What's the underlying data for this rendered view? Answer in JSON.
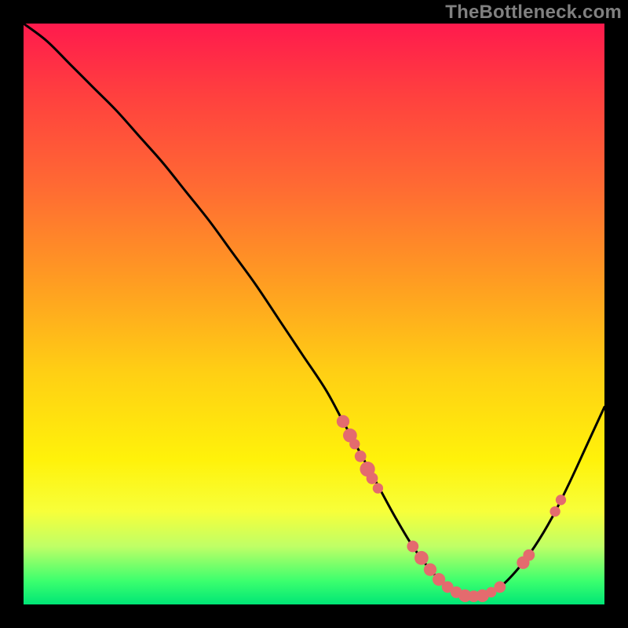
{
  "watermark": "TheBottleneck.com",
  "colors": {
    "background": "#000000",
    "curve": "#000000",
    "dot": "#e46b6e",
    "gradient_top": "#ff1a4d",
    "gradient_bottom": "#00e676"
  },
  "chart_data": {
    "type": "line",
    "title": "",
    "xlabel": "",
    "ylabel": "",
    "xlim": [
      0,
      100
    ],
    "ylim": [
      0,
      100
    ],
    "series": [
      {
        "name": "bottleneck-curve",
        "x": [
          0,
          4,
          8,
          12,
          16,
          20,
          24,
          28,
          32,
          36,
          40,
          44,
          48,
          52,
          55,
          58,
          61,
          64,
          67,
          70,
          73,
          76,
          79,
          82,
          85,
          88,
          91,
          94,
          97,
          100
        ],
        "y": [
          100,
          97,
          93,
          89,
          85,
          80.5,
          76,
          71,
          66,
          60.5,
          55,
          49,
          43,
          37,
          31.5,
          26,
          20.5,
          15,
          10,
          6,
          3,
          1.5,
          1.5,
          3,
          6,
          10,
          15,
          21,
          27.5,
          34
        ]
      }
    ],
    "markers": [
      {
        "x": 55.0,
        "y": 31.5,
        "r": 1.1
      },
      {
        "x": 56.2,
        "y": 29.1,
        "r": 1.2
      },
      {
        "x": 57.0,
        "y": 27.6,
        "r": 0.9
      },
      {
        "x": 58.0,
        "y": 25.5,
        "r": 1.0
      },
      {
        "x": 59.2,
        "y": 23.3,
        "r": 1.3
      },
      {
        "x": 60.0,
        "y": 21.7,
        "r": 1.0
      },
      {
        "x": 61.0,
        "y": 20.0,
        "r": 0.9
      },
      {
        "x": 67.0,
        "y": 10.0,
        "r": 1.0
      },
      {
        "x": 68.5,
        "y": 8.0,
        "r": 1.2
      },
      {
        "x": 70.0,
        "y": 6.0,
        "r": 1.1
      },
      {
        "x": 71.5,
        "y": 4.3,
        "r": 1.1
      },
      {
        "x": 73.0,
        "y": 3.0,
        "r": 1.0
      },
      {
        "x": 74.5,
        "y": 2.1,
        "r": 1.0
      },
      {
        "x": 76.0,
        "y": 1.5,
        "r": 1.1
      },
      {
        "x": 77.5,
        "y": 1.4,
        "r": 1.0
      },
      {
        "x": 79.0,
        "y": 1.5,
        "r": 1.1
      },
      {
        "x": 80.5,
        "y": 2.1,
        "r": 0.9
      },
      {
        "x": 82.0,
        "y": 3.0,
        "r": 1.0
      },
      {
        "x": 86.0,
        "y": 7.2,
        "r": 1.1
      },
      {
        "x": 87.0,
        "y": 8.5,
        "r": 1.0
      },
      {
        "x": 91.5,
        "y": 16.0,
        "r": 0.9
      },
      {
        "x": 92.5,
        "y": 18.0,
        "r": 0.9
      }
    ]
  }
}
